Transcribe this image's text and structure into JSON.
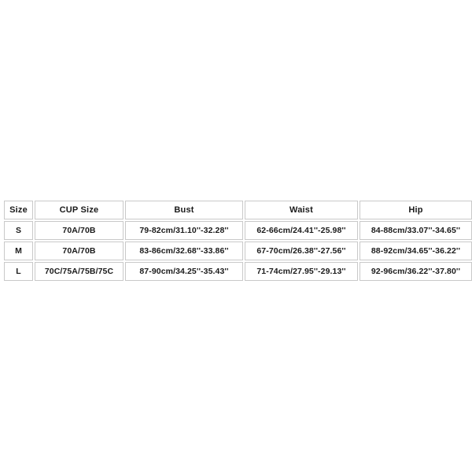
{
  "table": {
    "name": "size-chart",
    "columns": [
      {
        "key": "size",
        "label": "Size"
      },
      {
        "key": "cup",
        "label": "CUP Size"
      },
      {
        "key": "bust",
        "label": "Bust"
      },
      {
        "key": "waist",
        "label": "Waist"
      },
      {
        "key": "hip",
        "label": "Hip"
      }
    ],
    "rows": [
      {
        "size": "S",
        "cup": "70A/70B",
        "bust": "79-82cm/31.10''-32.28''",
        "waist": "62-66cm/24.41''-25.98''",
        "hip": "84-88cm/33.07''-34.65''"
      },
      {
        "size": "M",
        "cup": "70A/70B",
        "bust": "83-86cm/32.68''-33.86''",
        "waist": "67-70cm/26.38''-27.56''",
        "hip": "88-92cm/34.65''-36.22''"
      },
      {
        "size": "L",
        "cup": "70C/75A/75B/75C",
        "bust": "87-90cm/34.25''-35.43''",
        "waist": "71-74cm/27.95''-29.13''",
        "hip": "92-96cm/36.22''-37.80''"
      }
    ]
  },
  "colors": {
    "background": "#ffffff",
    "cell_border": "#c9c9c9",
    "text": "#1a1a1a"
  }
}
